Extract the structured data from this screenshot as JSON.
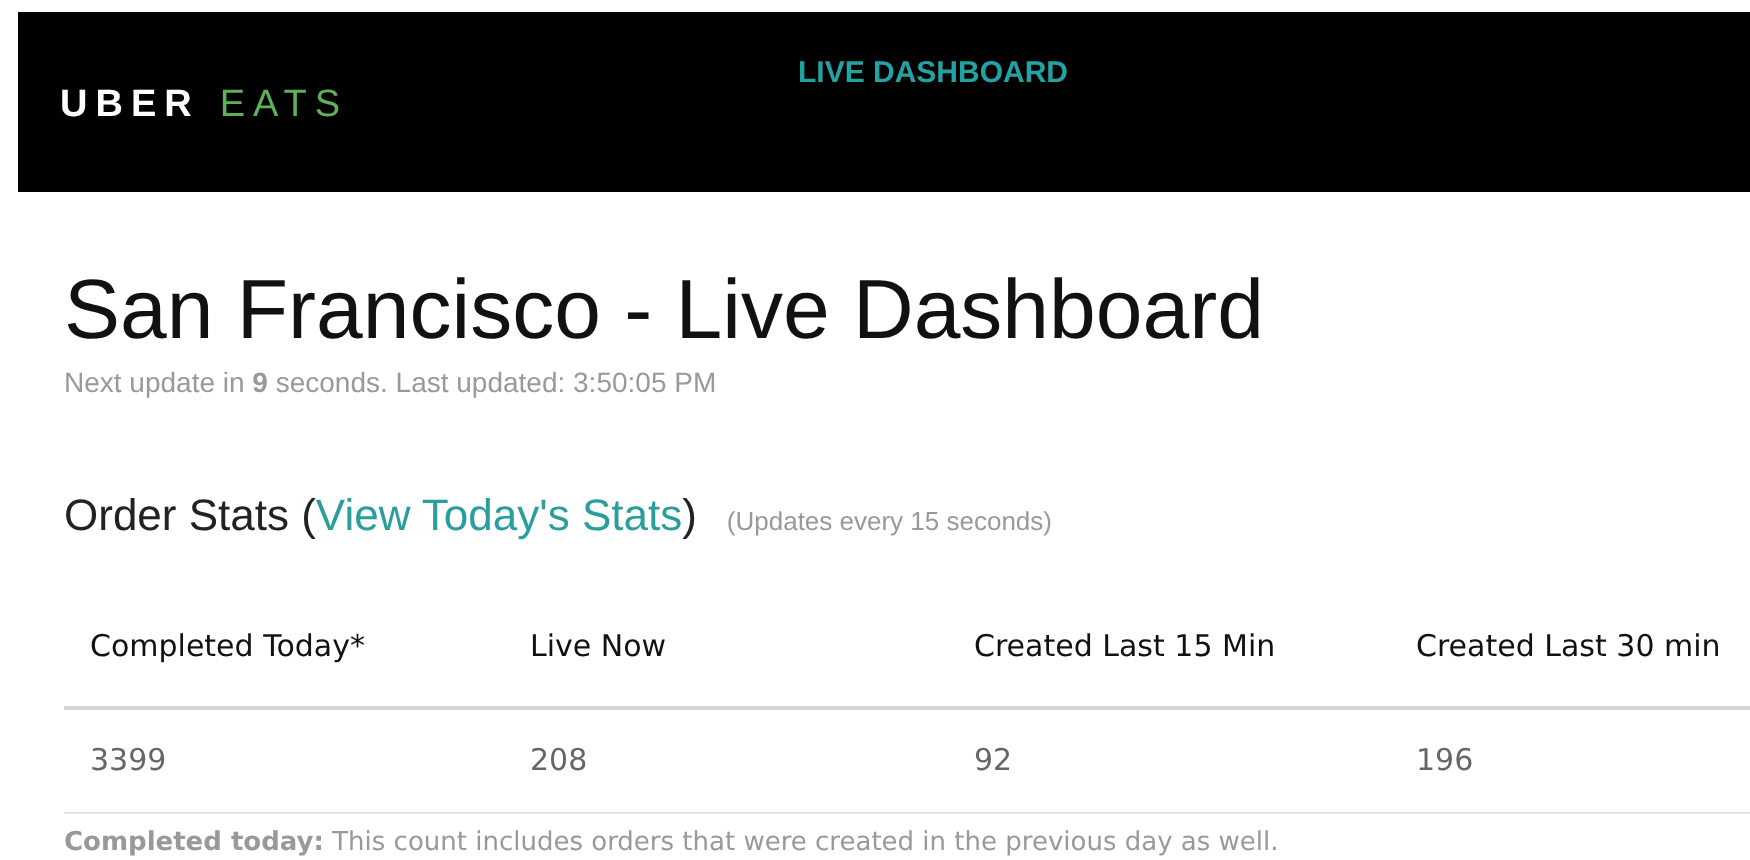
{
  "header": {
    "logo_primary": "UBER",
    "logo_secondary": "EATS",
    "nav_link": "LIVE DASHBOARD"
  },
  "title": "San Francisco - Live Dashboard",
  "update_line": "Next update in **9** seconds. Last updated: 3:50:05 PM",
  "section": {
    "title_start": "Order Stats (",
    "link": "View Today's Stats",
    "title_end": ")",
    "note": "(Updates every 15 seconds)"
  },
  "table": {
    "columns": [
      "Completed Today*",
      "Live Now",
      "Created Last 15 Min",
      "Created Last 30 min"
    ],
    "rows": [
      [
        "3399",
        "208",
        "92",
        "196"
      ]
    ]
  },
  "footnote": "**Completed today:** This count includes orders that were created in the previous day as well."
}
